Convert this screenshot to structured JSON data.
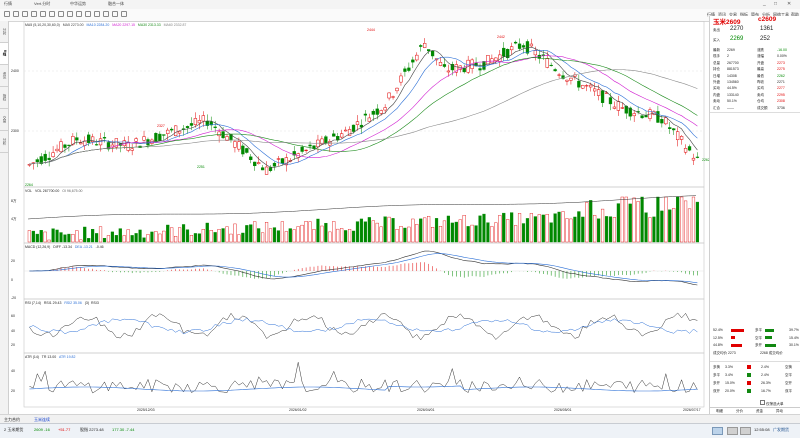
{
  "titlebar": {
    "tabs": [
      " 行情",
      "Vert.分时",
      "中华运势",
      "融合一体"
    ],
    "controls": [
      "_",
      "□",
      "✕"
    ]
  },
  "toolbar": {
    "menu": [
      "行情",
      "资讯",
      "交易",
      "指标",
      "简布",
      "分析",
      "网络工具",
      "帮助"
    ],
    "icons": [
      "back-icon",
      "forward-icon",
      "refresh-icon",
      "home-icon",
      "kline-icon",
      "time-share-icon",
      "draw-icon",
      "search-icon",
      "settings-icon",
      "zoom-in-icon",
      "zoom-out-icon",
      "lock-icon",
      "grid-icon",
      "layout-icon"
    ]
  },
  "left_tabs": [
    "分时",
    "K线",
    "资讯",
    "指标",
    "交易",
    "分析"
  ],
  "main_chart": {
    "ma_legend": [
      {
        "text": "MA5 (5,10,20,30,60,0)",
        "color": "#333333"
      },
      {
        "text": "MA5 2273.00",
        "color": "#444444"
      },
      {
        "text": "MA10 2284.20",
        "color": "#2b6fd6"
      },
      {
        "text": "MA20 2297.15",
        "color": "#d11fd1"
      },
      {
        "text": "MA30 2313.33",
        "color": "#1a8a1a"
      },
      {
        "text": "MA60 2332.87",
        "color": "#888888"
      }
    ],
    "price_axis": [
      "2400",
      "2300"
    ],
    "annotations": [
      "2444",
      "2442",
      "2327",
      "2251",
      "2264",
      "2262"
    ],
    "dates": [
      "2025/12/03",
      "2026/01/02",
      "2026/04/01",
      "2026/05/01",
      "2026/07/17"
    ]
  },
  "volume_chart": {
    "legend": [
      {
        "text": "VOL",
        "color": "#333333"
      },
      {
        "text": "VOL 267700.00",
        "color": "#333333"
      },
      {
        "text": "OI 96,675.00",
        "color": "#666666"
      }
    ],
    "axis": [
      "8万",
      "4万"
    ]
  },
  "macd_chart": {
    "legend": [
      {
        "text": "MACD (12,26,9)",
        "color": "#333333"
      },
      {
        "text": "DIFF -13.34",
        "color": "#333333"
      },
      {
        "text": "DEA -13.21",
        "color": "#2b6fd6"
      },
      {
        "text": "-0.46",
        "color": "#333333"
      }
    ],
    "axis": [
      "20",
      "0",
      "-20"
    ]
  },
  "rsi_chart": {
    "legend": [
      {
        "text": "RSI (7,14)",
        "color": "#333333"
      },
      {
        "text": "RSI1 29.43",
        "color": "#333333"
      },
      {
        "text": "RSI2 35.06",
        "color": "#2b6fd6"
      },
      {
        "text": "(3)",
        "color": "#333333"
      },
      {
        "text": "RSI3",
        "color": "#333333"
      }
    ],
    "axis": [
      "60",
      "40",
      "20"
    ]
  },
  "atr_chart": {
    "legend": [
      {
        "text": "ATR (14)",
        "color": "#333333"
      },
      {
        "text": "TR 13.00",
        "color": "#333333"
      },
      {
        "text": "ATR 19.82",
        "color": "#2b6fd6"
      }
    ],
    "axis": [
      "40",
      "20"
    ]
  },
  "quote_panel": {
    "name": "玉米2609",
    "code": "c2609",
    "bid_label": "卖出",
    "bid_price": "2270",
    "bid_vol": "1361",
    "ask_label": "买入",
    "ask_price": "2269",
    "ask_vol": "252",
    "rows": [
      {
        "l": "最新",
        "v": "2269",
        "l2": "涨跌",
        "v2": "-16.00",
        "c2": "grn"
      },
      {
        "l": "现手",
        "v": "2",
        "l2": "涨幅",
        "v2": "0.00%",
        "c2": "blk"
      },
      {
        "l": "总量",
        "v": "267700",
        "l2": "开盘",
        "v2": "2273",
        "c2": "red"
      },
      {
        "l": "持仓",
        "v": "881573",
        "l2": "最高",
        "v2": "2275",
        "c2": "red"
      },
      {
        "l": "日增",
        "v": "14308",
        "l2": "最低",
        "v2": "2262",
        "c2": "grn"
      },
      {
        "l": "外盘",
        "v": "134560",
        "l2": "昨收",
        "v2": "2271",
        "c2": "blk"
      },
      {
        "l": "买动",
        "v": "44.5%",
        "l2": "买均",
        "v2": "2277",
        "c2": "red"
      },
      {
        "l": "内盘",
        "v": "133140",
        "l2": "卖均",
        "v2": "2295",
        "c2": "red"
      },
      {
        "l": "卖动",
        "v": "50.1%",
        "l2": "仓均",
        "v2": "2308",
        "c2": "red"
      },
      {
        "l": "汇合",
        "v": "——",
        "l2": "成交额",
        "v2": "3736",
        "c2": "blk"
      }
    ],
    "stat_rows": [
      {
        "a": "52.4%",
        "b": "多平",
        "c": "39.7%"
      },
      {
        "a": "12.5%",
        "b": "空平",
        "c": "15.4%"
      },
      {
        "a": "44.8%",
        "b": "多开",
        "c": "30.1%"
      }
    ],
    "summary": {
      "l": "成交均价 2273",
      "r": "2268 成交均价"
    },
    "bottom_rows": [
      {
        "l": "多换",
        "a": "3.3%",
        "r": "空换",
        "b": "2.4%"
      },
      {
        "l": "多平",
        "a": "3.4%",
        "r": "空平",
        "b": "2.4%"
      },
      {
        "l": "多开",
        "a": "15.0%",
        "r": "空开",
        "b": "26.3%"
      },
      {
        "l": "双开",
        "a": "20.0%",
        "r": "双平",
        "b": "16.7%"
      }
    ],
    "checkbox_label": "仅筛选大单",
    "footer_tabs": [
      "明细",
      "分价",
      "资金",
      "异动"
    ]
  },
  "statusbar": {
    "items": [
      {
        "text": "主力合约",
        "cls": ""
      },
      {
        "text": "玉米连续",
        "cls": "blu"
      },
      {
        "text": "2 玉米期货",
        "cls": ""
      },
      {
        "text": "2609 -16",
        "cls": "grn"
      },
      {
        "text": "+51.77",
        "cls": "red"
      },
      {
        "text": "股指 2273.48",
        "cls": ""
      },
      {
        "text": "177.30  -7.44",
        "cls": "grn"
      }
    ]
  },
  "taskbar": {
    "clock": "12:55:08",
    "tray": [
      "广发期货"
    ]
  }
}
